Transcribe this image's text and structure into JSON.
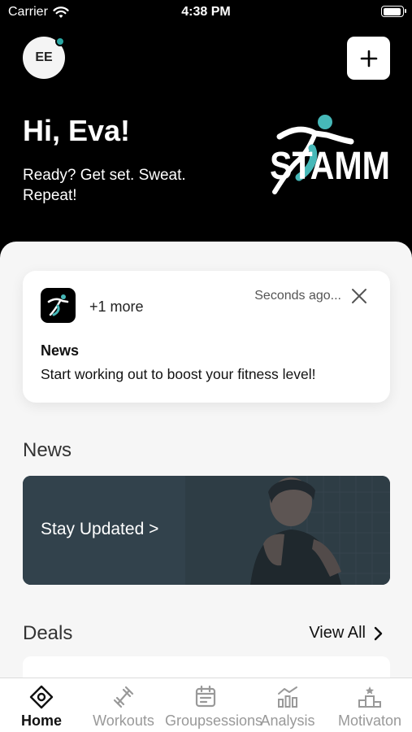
{
  "status_bar": {
    "carrier": "Carrier",
    "time": "4:38 PM"
  },
  "header": {
    "avatar_initials": "EE",
    "greeting": "Hi, Eva!",
    "tagline": "Ready? Get set. Sweat. Repeat!",
    "logo_text": "STAMM"
  },
  "notification": {
    "extra": "+1 more",
    "time": "Seconds ago...",
    "title": "News",
    "body": "Start working out to boost your fitness level!"
  },
  "news": {
    "section_title": "News",
    "card_label": "Stay Updated >"
  },
  "deals": {
    "section_title": "Deals",
    "view_all": "View All"
  },
  "tabs": [
    {
      "label": "Home",
      "icon": "home-icon"
    },
    {
      "label": "Workouts",
      "icon": "dumbbell-icon"
    },
    {
      "label": "Groupsessions",
      "icon": "calendar-icon"
    },
    {
      "label": "Analysis",
      "icon": "chart-icon"
    },
    {
      "label": "Motivaton",
      "icon": "podium-icon"
    }
  ],
  "colors": {
    "accent": "#46b8b8",
    "background_dark": "#000000"
  }
}
